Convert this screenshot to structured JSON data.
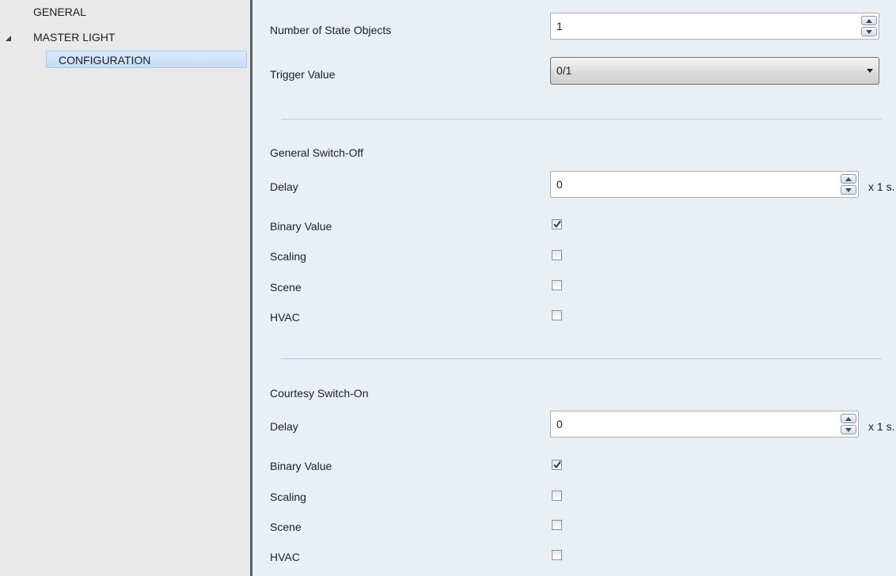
{
  "sidebar": {
    "items": [
      {
        "label": "GENERAL"
      },
      {
        "label": "MASTER LIGHT",
        "expanded": true
      },
      {
        "label": "CONFIGURATION",
        "selected": true
      }
    ]
  },
  "config": {
    "state_objects_label": "Number of State Objects",
    "state_objects_value": "1",
    "trigger_label": "Trigger Value",
    "trigger_value": "0/1"
  },
  "general_switch_off": {
    "title": "General Switch-Off",
    "delay_label": "Delay",
    "delay_value": "0",
    "delay_unit": "x 1 s.",
    "binary_label": "Binary Value",
    "binary_checked": true,
    "scaling_label": "Scaling",
    "scaling_checked": false,
    "scene_label": "Scene",
    "scene_checked": false,
    "hvac_label": "HVAC",
    "hvac_checked": false
  },
  "courtesy_switch_on": {
    "title": "Courtesy Switch-On",
    "delay_label": "Delay",
    "delay_value": "0",
    "delay_unit": "x 1 s.",
    "binary_label": "Binary Value",
    "binary_checked": true,
    "scaling_label": "Scaling",
    "scaling_checked": false,
    "scene_label": "Scene",
    "scene_checked": false,
    "hvac_label": "HVAC",
    "hvac_checked": false
  },
  "colors": {
    "panel_bg": "#e9f0f5",
    "sidebar_bg": "#e9e9e9",
    "selection": "#c3dcf8",
    "check_mark": "#2a2f6e"
  }
}
